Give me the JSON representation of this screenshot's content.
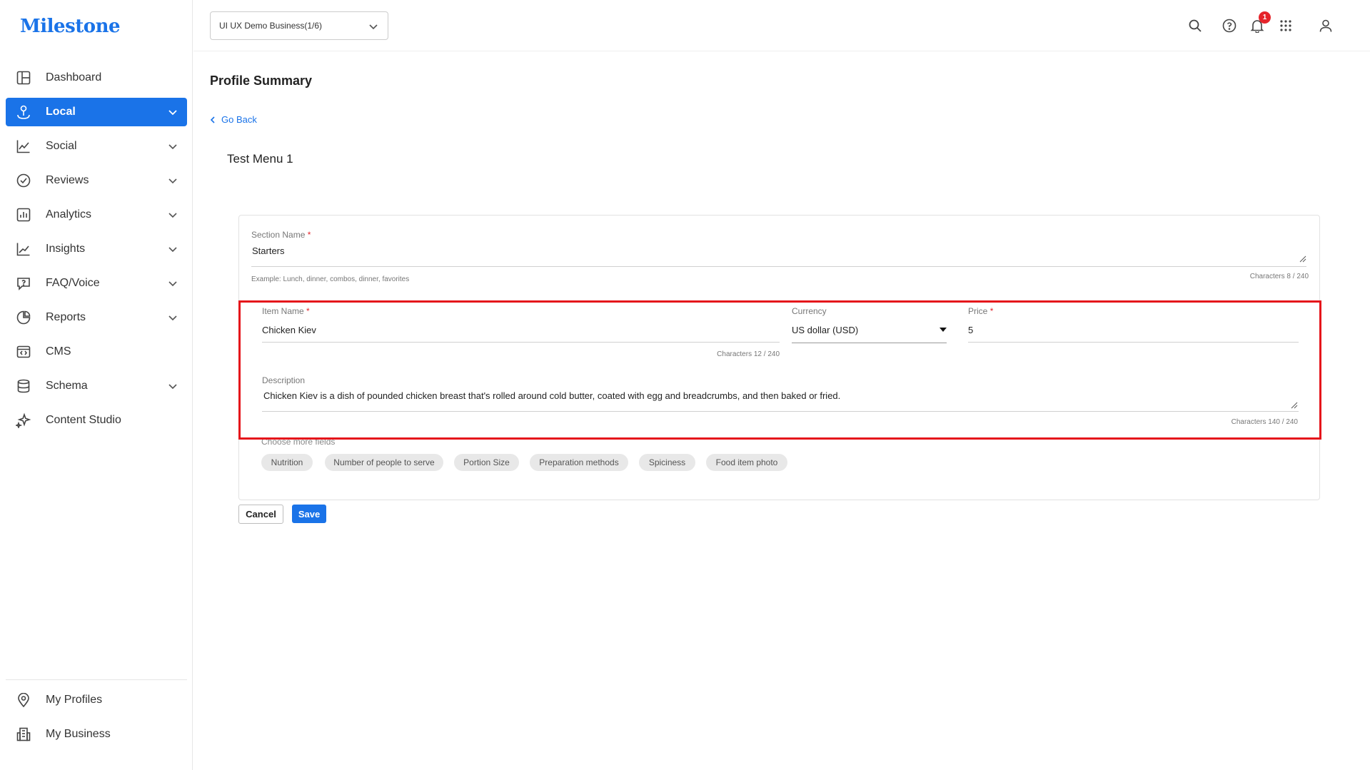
{
  "brand": {
    "logo_text": "Milestone",
    "accent": "#1a73e8"
  },
  "sidebar": {
    "items": [
      {
        "label": "Dashboard",
        "icon": "dashboard-icon",
        "has_chevron": false,
        "active": false
      },
      {
        "label": "Local",
        "icon": "local-pin-icon",
        "has_chevron": true,
        "active": true
      },
      {
        "label": "Social",
        "icon": "social-chart-icon",
        "has_chevron": true,
        "active": false
      },
      {
        "label": "Reviews",
        "icon": "reviews-check-icon",
        "has_chevron": true,
        "active": false
      },
      {
        "label": "Analytics",
        "icon": "analytics-bar-icon",
        "has_chevron": true,
        "active": false
      },
      {
        "label": "Insights",
        "icon": "insights-line-icon",
        "has_chevron": true,
        "active": false
      },
      {
        "label": "FAQ/Voice",
        "icon": "faq-question-icon",
        "has_chevron": true,
        "active": false
      },
      {
        "label": "Reports",
        "icon": "reports-pie-icon",
        "has_chevron": true,
        "active": false
      },
      {
        "label": "CMS",
        "icon": "cms-code-icon",
        "has_chevron": false,
        "active": false
      },
      {
        "label": "Schema",
        "icon": "schema-database-icon",
        "has_chevron": true,
        "active": false
      },
      {
        "label": "Content Studio",
        "icon": "content-studio-sparkle-icon",
        "has_chevron": false,
        "active": false
      }
    ],
    "bottom_items": [
      {
        "label": "My Profiles",
        "icon": "location-pin-icon"
      },
      {
        "label": "My Business",
        "icon": "building-icon"
      }
    ]
  },
  "header": {
    "business_selector": "UI UX Demo Business(1/6)",
    "notification_count": "1",
    "icons": [
      "search-icon",
      "help-icon",
      "bell-icon",
      "apps-grid-icon",
      "user-icon"
    ]
  },
  "main": {
    "page_title": "Profile Summary",
    "go_back": "Go Back",
    "menu_title": "Test Menu 1",
    "section_name": {
      "label": "Section Name",
      "required_mark": "*",
      "value": "Starters",
      "hint": "Example: Lunch, dinner, combos, dinner, favorites",
      "counter": "Characters 8 / 240"
    },
    "item_name": {
      "label": "Item Name",
      "required_mark": "*",
      "value": "Chicken Kiev",
      "counter": "Characters 12 / 240"
    },
    "currency": {
      "label": "Currency",
      "value": "US dollar (USD)"
    },
    "price": {
      "label": "Price",
      "required_mark": "*",
      "value": "5"
    },
    "description": {
      "label": "Description",
      "value": "Chicken Kiev is a dish of pounded chicken breast that's rolled around cold butter, coated with egg and breadcrumbs, and then baked or fried.",
      "counter": "Characters 140 / 240"
    },
    "more_fields_label": "Choose more fields",
    "chips": [
      "Nutrition",
      "Number of people to serve",
      "Portion Size",
      "Preparation methods",
      "Spiciness",
      "Food item photo"
    ],
    "cancel_label": "Cancel",
    "save_label": "Save",
    "highlight_color": "#e5141b"
  }
}
